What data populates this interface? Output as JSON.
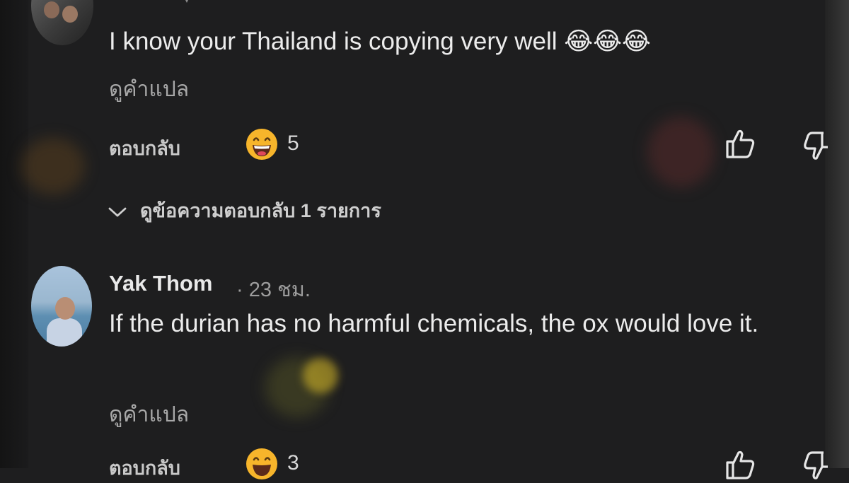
{
  "comments": [
    {
      "text": "I know your Thailand is copying very well 😂😂😂",
      "translate_label": "ดูคำแปล",
      "reply_label": "ตอบกลับ",
      "reaction_count": "5",
      "replies_label": "ดูข้อความตอบกลับ 1 รายการ"
    },
    {
      "author": "Yak Thom",
      "time": "· 23 ชม.",
      "text": "If the durian has no harmful chemicals, the ox would love it.",
      "translate_label": "ดูคำแปล",
      "reply_label": "ตอบกลับ",
      "reaction_count": "3"
    }
  ],
  "icons": {
    "reaction": "grinning-face-emoji",
    "laugh": "tears-of-joy-emoji",
    "like": "thumbs-up-icon",
    "dislike": "thumbs-down-icon",
    "expand": "chevron-down-icon"
  },
  "colors": {
    "background": "#1e1e1f",
    "text": "#ececec",
    "secondary": "#a8a8a8",
    "emoji": "#f7b52b"
  }
}
